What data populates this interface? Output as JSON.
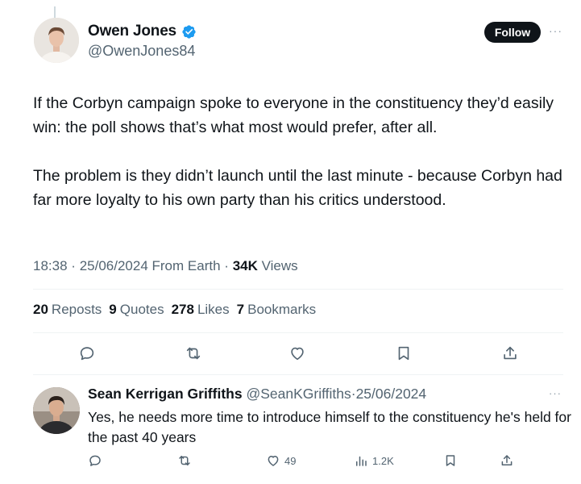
{
  "tweet": {
    "author": {
      "name": "Owen Jones",
      "handle": "@OwenJones84",
      "verified": true
    },
    "follow_label": "Follow",
    "more_label": "···",
    "paragraphs": [
      "If the Corbyn campaign spoke to everyone in the constituency they’d easily win: the poll shows that’s what most would prefer, after all.",
      "The problem is they didn’t launch until the last minute - because Corbyn had far more loyalty to his own party than his critics understood."
    ],
    "meta": {
      "time": "18:38",
      "date": "25/06/2024",
      "source": "From Earth",
      "views_count": "34K",
      "views_label": "Views",
      "sep": "·"
    },
    "stats": {
      "reposts": {
        "count": "20",
        "label": "Reposts"
      },
      "quotes": {
        "count": "9",
        "label": "Quotes"
      },
      "likes": {
        "count": "278",
        "label": "Likes"
      },
      "bookmarks": {
        "count": "7",
        "label": "Bookmarks"
      }
    }
  },
  "reply": {
    "author": {
      "name": "Sean Kerrigan Griffiths",
      "handle": "@SeanKGriffiths",
      "date": "25/06/2024",
      "sep": "·"
    },
    "more_label": "···",
    "text": "Yes, he needs more time to introduce himself to the constituency he's held for the past 40 years",
    "likes_count": "49",
    "views_count": "1.2K"
  },
  "colors": {
    "text": "#0f1419",
    "secondary": "#536471",
    "verified": "#1d9bf0",
    "divider": "#eff3f4"
  },
  "icons": [
    "verified-badge-icon",
    "reply-icon",
    "repost-icon",
    "like-icon",
    "bookmark-icon",
    "share-icon",
    "views-icon",
    "more-icon"
  ]
}
